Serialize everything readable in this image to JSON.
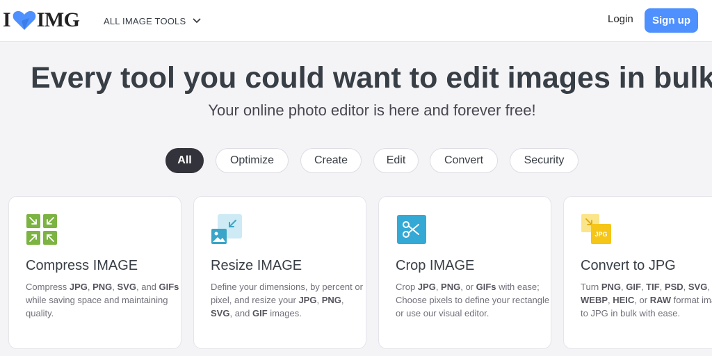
{
  "header": {
    "logo_letter": "I",
    "logo_word": "IMG",
    "tools_menu_label": "ALL IMAGE TOOLS",
    "login_label": "Login",
    "signup_label": "Sign up"
  },
  "hero": {
    "title": "Every tool you could want to edit images in bulk",
    "subtitle": "Your online photo editor is here and forever free!"
  },
  "filters": [
    {
      "label": "All",
      "active": true
    },
    {
      "label": "Optimize",
      "active": false
    },
    {
      "label": "Create",
      "active": false
    },
    {
      "label": "Edit",
      "active": false
    },
    {
      "label": "Convert",
      "active": false
    },
    {
      "label": "Security",
      "active": false
    }
  ],
  "cards": [
    {
      "title": "Compress IMAGE",
      "icon": "compress-icon",
      "description": [
        {
          "text": "Compress ",
          "bold": false
        },
        {
          "text": "JPG",
          "bold": true
        },
        {
          "text": ", ",
          "bold": false
        },
        {
          "text": "PNG",
          "bold": true
        },
        {
          "text": ", ",
          "bold": false
        },
        {
          "text": "SVG",
          "bold": true
        },
        {
          "text": ", and ",
          "bold": false
        },
        {
          "text": "GIFs",
          "bold": true
        },
        {
          "text": " while saving space and maintaining quality.",
          "bold": false
        }
      ]
    },
    {
      "title": "Resize IMAGE",
      "icon": "resize-icon",
      "description": [
        {
          "text": "Define your dimensions, by percent or pixel, and resize your ",
          "bold": false
        },
        {
          "text": "JPG",
          "bold": true
        },
        {
          "text": ", ",
          "bold": false
        },
        {
          "text": "PNG",
          "bold": true
        },
        {
          "text": ", ",
          "bold": false
        },
        {
          "text": "SVG",
          "bold": true
        },
        {
          "text": ", and ",
          "bold": false
        },
        {
          "text": "GIF",
          "bold": true
        },
        {
          "text": " images.",
          "bold": false
        }
      ]
    },
    {
      "title": "Crop IMAGE",
      "icon": "crop-scissors-icon",
      "description": [
        {
          "text": "Crop ",
          "bold": false
        },
        {
          "text": "JPG",
          "bold": true
        },
        {
          "text": ", ",
          "bold": false
        },
        {
          "text": "PNG",
          "bold": true
        },
        {
          "text": ", or ",
          "bold": false
        },
        {
          "text": "GIFs",
          "bold": true
        },
        {
          "text": " with ease; Choose pixels to define your rectangle or use our visual editor.",
          "bold": false
        }
      ]
    },
    {
      "title": "Convert to JPG",
      "icon": "convert-to-jpg-icon",
      "icon_badge": "JPG",
      "description": [
        {
          "text": "Turn ",
          "bold": false
        },
        {
          "text": "PNG",
          "bold": true
        },
        {
          "text": ", ",
          "bold": false
        },
        {
          "text": "GIF",
          "bold": true
        },
        {
          "text": ", ",
          "bold": false
        },
        {
          "text": "TIF",
          "bold": true
        },
        {
          "text": ", ",
          "bold": false
        },
        {
          "text": "PSD",
          "bold": true
        },
        {
          "text": ", ",
          "bold": false
        },
        {
          "text": "SVG",
          "bold": true
        },
        {
          "text": ", ",
          "bold": false
        },
        {
          "text": "WEBP",
          "bold": true
        },
        {
          "text": ", ",
          "bold": false
        },
        {
          "text": "HEIC",
          "bold": true
        },
        {
          "text": ", or ",
          "bold": false
        },
        {
          "text": "RAW",
          "bold": true
        },
        {
          "text": " format images to JPG in bulk with ease.",
          "bold": false
        }
      ]
    }
  ],
  "colors": {
    "accent": "#4d90fe",
    "heart": "#4d90fe",
    "compress": "#7cb342",
    "resize": "#3aa5c8",
    "crop": "#34a9d6",
    "convert": "#f5c518"
  }
}
